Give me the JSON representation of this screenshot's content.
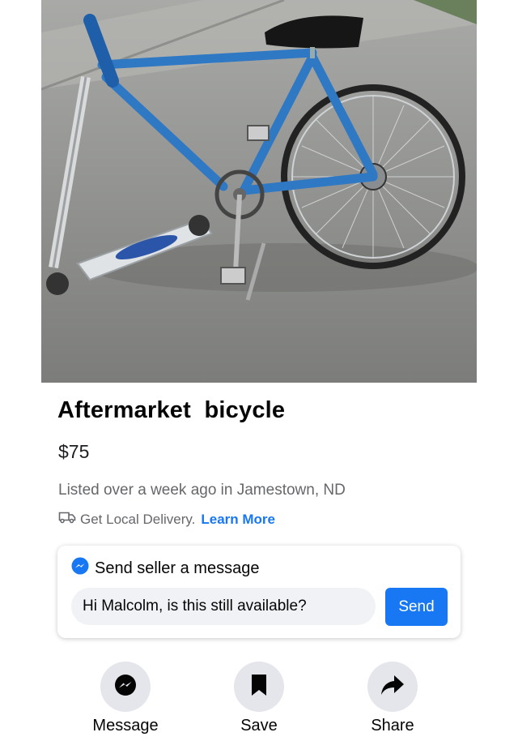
{
  "listing": {
    "title": "Aftermarket  bicycle",
    "price": "$75",
    "listed_text": "Listed over a week ago in Jamestown, ND",
    "delivery_text": "Get Local Delivery.",
    "learn_more": "Learn More",
    "photo_alt": "Bicycle with scooter front"
  },
  "message_card": {
    "header": "Send seller a message",
    "input_value": "Hi Malcolm, is this still available?",
    "send_label": "Send"
  },
  "actions": [
    {
      "label": "Message",
      "icon": "messenger-icon"
    },
    {
      "label": "Save",
      "icon": "bookmark-icon"
    },
    {
      "label": "Share",
      "icon": "share-arrow-icon"
    }
  ],
  "colors": {
    "accent": "#1877f2",
    "secondary_text": "#65676b",
    "action_circle": "#e4e6eb"
  }
}
